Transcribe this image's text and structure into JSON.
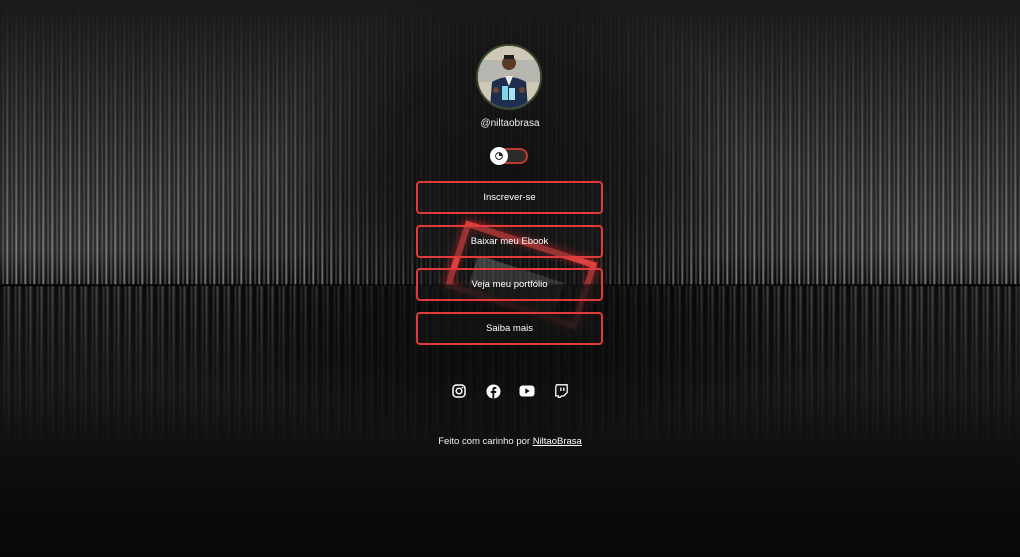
{
  "profile": {
    "handle": "@niltaobrasa"
  },
  "theme_toggle": {
    "icon": "theme-toggle-icon",
    "accent": "#e03a3a"
  },
  "links": [
    {
      "label": "Inscrever-se"
    },
    {
      "label": "Baixar meu Ebook"
    },
    {
      "label": "Veja meu portfólio"
    },
    {
      "label": "Saiba mais"
    }
  ],
  "socials": [
    {
      "icon": "instagram-icon"
    },
    {
      "icon": "facebook-icon"
    },
    {
      "icon": "youtube-icon"
    },
    {
      "icon": "twitch-icon"
    }
  ],
  "footer": {
    "prefix": "Feito com carinho por",
    "author": "NiltaoBrasa"
  },
  "colors": {
    "button_border": "#e03a3a",
    "background": "#0b0b0b",
    "text": "#ffffff"
  }
}
